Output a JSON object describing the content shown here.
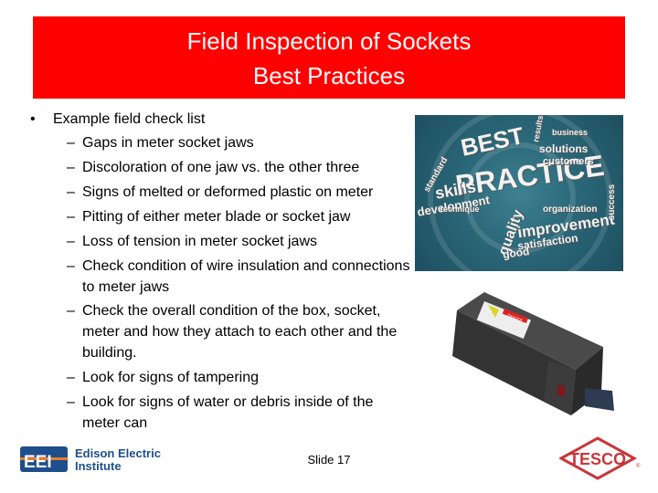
{
  "title": {
    "line1": "Field Inspection of Sockets",
    "line2": "Best Practices"
  },
  "bullets": {
    "main": "Example field check list",
    "bullet_glyph": "•",
    "dash_glyph": "–",
    "items": [
      [
        "Gaps in meter socket jaws"
      ],
      [
        "Discoloration of one jaw vs. the other three"
      ],
      [
        "Signs of melted or deformed plastic on meter"
      ],
      [
        "Pitting of either meter blade or socket jaw"
      ],
      [
        "Loss of tension in meter socket jaws"
      ],
      [
        "Check condition of  wire insulation and connections",
        "to  meter jaws"
      ],
      [
        "Check the overall condition of the box, socket,",
        "meter and how they attach to each other and the",
        "building."
      ],
      [
        "Look for signs of tampering"
      ],
      [
        "Look for signs of water or debris inside of the",
        "meter can"
      ]
    ]
  },
  "images": {
    "best_practice": {
      "words": [
        "BEST",
        "PRACTICE",
        "solutions",
        "customers",
        "skills",
        "development",
        "quality",
        "improvement",
        "satisfaction",
        "good",
        "organization",
        "standard",
        "technique",
        "business",
        "results",
        "success"
      ]
    },
    "device": {
      "label": "DANGER"
    }
  },
  "footer": {
    "slide_number": "Slide 17",
    "eei_logo": {
      "mark": "EEI",
      "line1": "Edison Electric",
      "line2": "Institute",
      "color": "#1f4e8c"
    },
    "tesco_logo": {
      "text": "TESCO",
      "color": "#c8373a"
    }
  },
  "colors": {
    "title_bg": "#fe0000",
    "title_text": "#ffffff"
  }
}
